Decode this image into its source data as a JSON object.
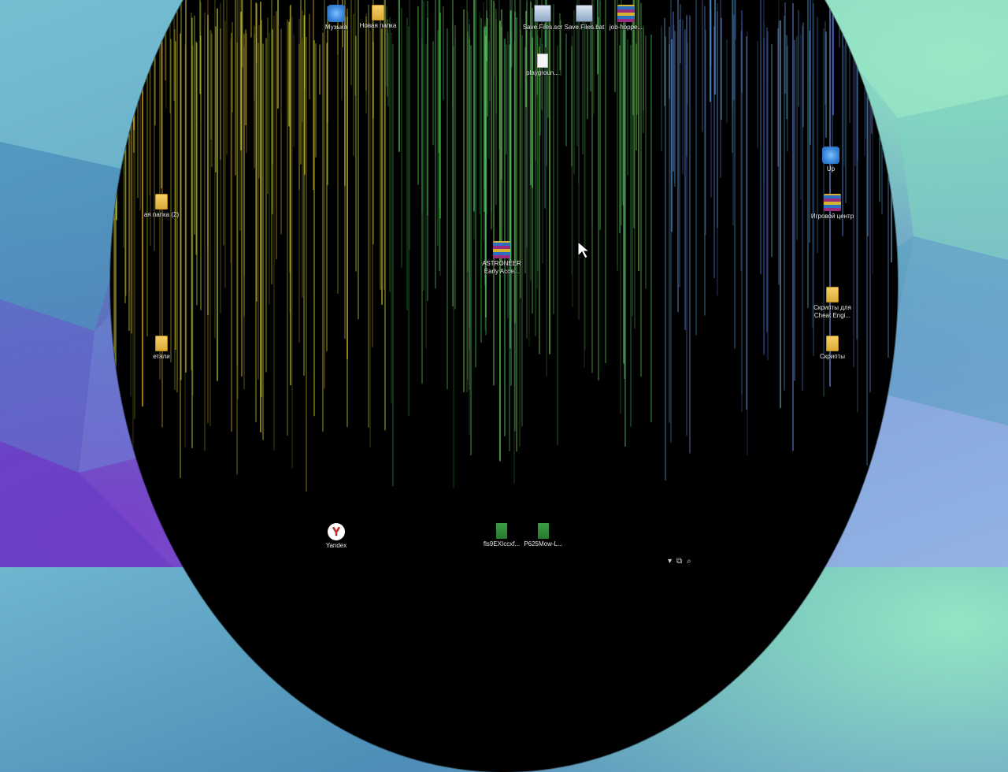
{
  "desktop_icons": [
    {
      "label": "Музыка",
      "icon": "app-music-icon"
    },
    {
      "label": "Новая папка",
      "icon": "folder-icon"
    },
    {
      "label": "Save.Files.scr",
      "icon": "screen-saver-icon"
    },
    {
      "label": "Save.Files.bat",
      "icon": "batch-file-icon"
    },
    {
      "label": "job-hoppe...",
      "icon": "archive-icon"
    },
    {
      "label": "playgroun...",
      "icon": "document-icon"
    },
    {
      "label": "ASTRONEER Early Acce...",
      "icon": "archive-icon"
    },
    {
      "label": "ая папка (2)",
      "icon": "folder-icon"
    },
    {
      "label": "етали",
      "icon": "folder-icon"
    },
    {
      "label": "Игровой центр",
      "icon": "game-center-icon"
    },
    {
      "label": "Скрипты для Cheat Engi...",
      "icon": "folder-icon"
    },
    {
      "label": "Скрипты",
      "icon": "folder-icon"
    },
    {
      "label": "Yandex",
      "icon": "yandex-icon"
    },
    {
      "label": "fls9EXIccxf...",
      "icon": "green-file-icon"
    },
    {
      "label": "P625Mow-L...",
      "icon": "green-file-icon"
    },
    {
      "label": "Up",
      "icon": "app-icon"
    }
  ],
  "taskbar_tray": {
    "icons": [
      "chevron-up-icon",
      "window-icon",
      "search-icon"
    ]
  }
}
